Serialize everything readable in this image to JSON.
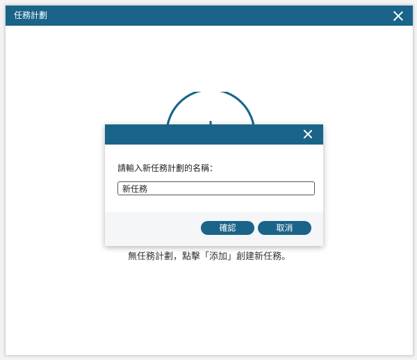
{
  "window": {
    "title": "任務計劃"
  },
  "empty_state": {
    "message": "無任務計劃，點擊「添加」創建新任務。"
  },
  "dialog": {
    "prompt": "請輸入新任務計劃的名稱：",
    "input_value": "新任務",
    "confirm_label": "確認",
    "cancel_label": "取消"
  },
  "colors": {
    "accent": "#1a6489"
  },
  "icons": {
    "window_close": "close-icon",
    "dialog_close": "close-icon",
    "empty_state": "clock-icon"
  }
}
